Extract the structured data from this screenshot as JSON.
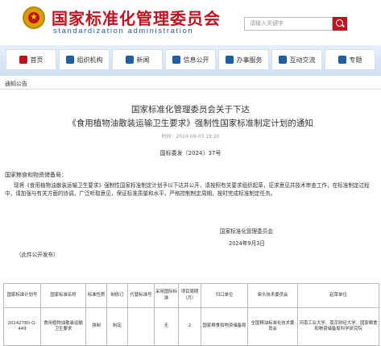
{
  "site": {
    "title": "国家标准化管理委员会",
    "subtitle": "standardization administration"
  },
  "search": {
    "placeholder": "请输入关键字"
  },
  "nav": [
    {
      "label": "首页"
    },
    {
      "label": "组织机构"
    },
    {
      "label": "新闻"
    },
    {
      "label": "信息公开"
    },
    {
      "label": "办事服务"
    },
    {
      "label": "互动交流"
    },
    {
      "label": "专题"
    }
  ],
  "breadcrumb": "通知公告",
  "article": {
    "title_line1": "国家标准化管理委员会关于下达",
    "title_line2": "《食用植物油散装运输卫生要求》强制性国家标准制定计划的通知",
    "meta": "时间：2024-09-03 19:20",
    "doc_no": "国标委发〔2024〕37号",
    "addressee": "国家粮食和物资储备局：",
    "body": "现将《食用植物油散装运输卫生要求》强制性国家标准制定计划予以下达并公开，请按照有关要求组织起草，征求意见并技术审查工作，在标准制定过程中，请加强与有关方面的协调，广泛听取意见，保证标准质量和水平，严格控制制定周期，按时完成标准制定任务。",
    "signature": "国家标准化管理委员会",
    "date": "2024年9月3日",
    "note": "（此件公开发布）"
  },
  "table": {
    "headers": [
      "国家标准计划号",
      "国家标准名称",
      "标准性质",
      "制修订",
      "代替标准号",
      "采用国际标准",
      "项目周期（月）",
      "归口单位",
      "牵头技术委员会",
      "起草单位"
    ],
    "rows": [
      [
        "20242780-Q-449",
        "食用植物油散装运输卫生要求",
        "强制",
        "制定",
        "",
        "无",
        "2",
        "国家粮食和物资储备局",
        "全国粮油标准化技术委员会",
        "河南工业大学、南京财经大学、国家粮食和物资储备局科学研究院"
      ]
    ]
  }
}
